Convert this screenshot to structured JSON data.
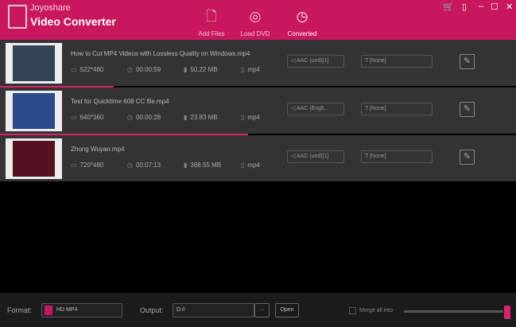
{
  "brand": {
    "line1": "Joyoshare",
    "line2": "Video Converter"
  },
  "toolbar": [
    {
      "label": "Add Files",
      "icon": "add-file-icon"
    },
    {
      "label": "Load DVD",
      "icon": "dvd-icon"
    },
    {
      "label": "Converted",
      "icon": "clock-icon"
    }
  ],
  "files": [
    {
      "name": "How to Cut MP4 Videos with Lossless Quality on Windows.mp4",
      "resolution": "522*480",
      "duration": "00:00:59",
      "size": "50.22 MB",
      "format": "mp4",
      "audio": "AAC (und)[1]",
      "subtitle": "[None]",
      "progress": 22,
      "thumb": "#345"
    },
    {
      "name": "Test for Quicktime 608 CC file.mp4",
      "resolution": "640*360",
      "duration": "00:00:28",
      "size": "23.83 MB",
      "format": "mp4",
      "audio": "AAC (Engli...",
      "subtitle": "[None]",
      "progress": 48,
      "thumb": "#2a4a8a"
    },
    {
      "name": "Zhong Wuyan.mp4",
      "resolution": "720*480",
      "duration": "00:07:13",
      "size": "368.55 MB",
      "format": "mp4",
      "audio": "AAC (und)[1]",
      "subtitle": "[None]",
      "progress": 0,
      "thumb": "#512"
    }
  ],
  "footer": {
    "format_label": "Format:",
    "format_value": "HD MP4",
    "output_label": "Output:",
    "output_value": "D://",
    "browse": "···",
    "open": "Open",
    "merge": "Merge all into"
  },
  "colors": {
    "accent": "#c8175c"
  }
}
